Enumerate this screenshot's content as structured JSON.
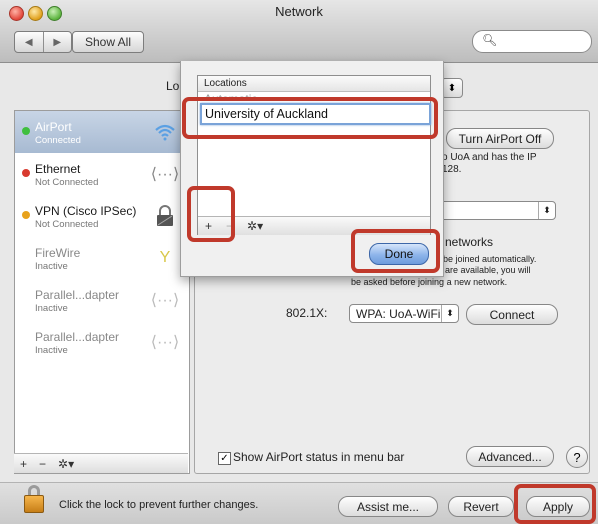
{
  "window": {
    "title": "Network"
  },
  "toolbar": {
    "back_label": "◀",
    "forward_label": "▶",
    "show_all_label": "Show All",
    "search_placeholder": ""
  },
  "location": {
    "label": "Lo",
    "value": ""
  },
  "services": [
    {
      "name": "AirPort",
      "status": "Connected",
      "dot_color": "#3fbf3f",
      "icon": "wifi-icon",
      "selected": true
    },
    {
      "name": "Ethernet",
      "status": "Not Connected",
      "dot_color": "#d83a2f",
      "icon": "ethernet-icon"
    },
    {
      "name": "VPN (Cisco IPSec)",
      "status": "Not Connected",
      "dot_color": "#e8a21b",
      "icon": "vpn-lock-icon"
    },
    {
      "name": "FireWire",
      "status": "Inactive",
      "dot_color": "",
      "icon": "firewire-icon"
    },
    {
      "name": "Parallel...dapter",
      "status": "Inactive",
      "dot_color": "",
      "icon": "ethernet-icon"
    },
    {
      "name": "Parallel...dapter",
      "status": "Inactive",
      "dot_color": "",
      "icon": "ethernet-icon"
    }
  ],
  "sidebar_footer": {
    "add": "+",
    "remove": "−",
    "action": "✲▾"
  },
  "panel": {
    "turn_off_label": "Turn AirPort Off",
    "info_line1": "o UoA and has the IP",
    "info_line2": "128.",
    "networks_title": "networks",
    "networks_desc1": "be joined automatically.",
    "networks_desc2": "s are available, you will",
    "networks_desc3": "be asked before joining a new network.",
    "dot1x_label": "802.1X:",
    "dot1x_value": "WPA: UoA-WiFi",
    "connect_label": "Connect",
    "show_status_label": "Show AirPort status in menu bar",
    "advanced_label": "Advanced...",
    "help_label": "?"
  },
  "bottom": {
    "lock_text": "Click the lock to prevent further changes.",
    "assist_label": "Assist me...",
    "revert_label": "Revert",
    "apply_label": "Apply"
  },
  "sheet": {
    "column_header": "Locations",
    "automatic_label": "Automatic",
    "edit_value": "University of Auckland",
    "add": "+",
    "remove": "−",
    "action": "✲▾",
    "done_label": "Done"
  },
  "colors": {
    "highlight": "#c0392b",
    "selection": "#a7bad2",
    "default_button": "#8db4ea"
  }
}
